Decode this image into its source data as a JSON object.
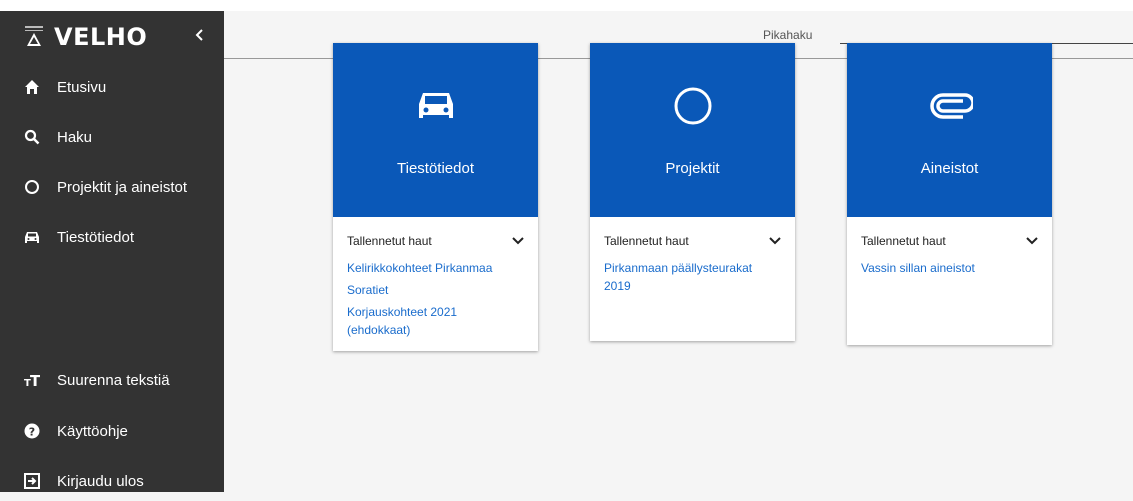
{
  "app": {
    "title": "VELHO",
    "collapse_icon": "chevron-left-icon"
  },
  "sidebar": {
    "items": [
      {
        "label": "Etusivu",
        "icon": "home-icon"
      },
      {
        "label": "Haku",
        "icon": "search-icon"
      },
      {
        "label": "Projektit ja aineistot",
        "icon": "circle-icon"
      },
      {
        "label": "Tiestötiedot",
        "icon": "car-icon"
      }
    ],
    "bottom_items": [
      {
        "label": "Suurenna tekstiä",
        "icon": "text-size-icon"
      },
      {
        "label": "Käyttöohje",
        "icon": "help-icon"
      },
      {
        "label": "Kirjaudu ulos",
        "icon": "logout-icon"
      }
    ]
  },
  "search": {
    "label": "Pikahaku"
  },
  "cards": [
    {
      "title": "Tiestötiedot",
      "icon": "car-icon",
      "saved_label": "Tallennetut haut",
      "links": [
        "Kelirikkokohteet Pirkanmaa",
        "Soratiet",
        "Korjauskohteet 2021 (ehdokkaat)"
      ]
    },
    {
      "title": "Projektit",
      "icon": "circle-icon",
      "saved_label": "Tallennetut haut",
      "links": [
        "Pirkanmaan päällysteurakat 2019"
      ]
    },
    {
      "title": "Aineistot",
      "icon": "paperclip-icon",
      "saved_label": "Tallennetut haut",
      "links": [
        "Vassin sillan aineistot"
      ]
    }
  ],
  "colors": {
    "sidebar": "#333333",
    "card_header": "#0a58b8",
    "link": "#1a6ccc",
    "background": "#f5f5f5"
  }
}
